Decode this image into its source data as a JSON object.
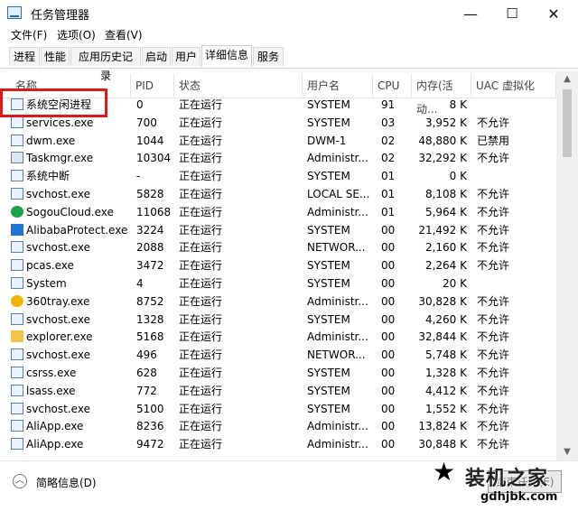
{
  "window": {
    "title": "任务管理器",
    "minimize": "—",
    "maximize": "☐",
    "close": "✕"
  },
  "menu": [
    "文件(F)",
    "选项(O)",
    "查看(V)"
  ],
  "tabs": [
    "进程",
    "性能",
    "应用历史记录",
    "启动",
    "用户",
    "详细信息",
    "服务"
  ],
  "active_tab": "详细信息",
  "columns": {
    "name": "名称",
    "pid": "PID",
    "status": "状态",
    "user": "用户名",
    "cpu": "CPU",
    "memory": "内存(活动...",
    "uac": "UAC 虚拟化"
  },
  "rows": [
    {
      "name": "系统空闲进程",
      "pid": "0",
      "status": "正在运行",
      "user": "SYSTEM",
      "cpu": "91",
      "memory": "8 K",
      "uac": "",
      "icon": "window-icon"
    },
    {
      "name": "services.exe",
      "pid": "700",
      "status": "正在运行",
      "user": "SYSTEM",
      "cpu": "03",
      "memory": "3,952 K",
      "uac": "不允许",
      "icon": "window-icon"
    },
    {
      "name": "dwm.exe",
      "pid": "1044",
      "status": "正在运行",
      "user": "DWM-1",
      "cpu": "02",
      "memory": "48,880 K",
      "uac": "已禁用",
      "icon": "window-icon"
    },
    {
      "name": "Taskmgr.exe",
      "pid": "10304",
      "status": "正在运行",
      "user": "Administr...",
      "cpu": "02",
      "memory": "32,292 K",
      "uac": "不允许",
      "icon": "taskmgr-icon"
    },
    {
      "name": "系统中断",
      "pid": "-",
      "status": "正在运行",
      "user": "SYSTEM",
      "cpu": "01",
      "memory": "0 K",
      "uac": "",
      "icon": "window-icon"
    },
    {
      "name": "svchost.exe",
      "pid": "5828",
      "status": "正在运行",
      "user": "LOCAL SE...",
      "cpu": "01",
      "memory": "8,108 K",
      "uac": "不允许",
      "icon": "window-icon"
    },
    {
      "name": "SogouCloud.exe",
      "pid": "11068",
      "status": "正在运行",
      "user": "Administr...",
      "cpu": "01",
      "memory": "5,964 K",
      "uac": "不允许",
      "icon": "sogou-icon"
    },
    {
      "name": "AlibabaProtect.exe",
      "pid": "3224",
      "status": "正在运行",
      "user": "SYSTEM",
      "cpu": "00",
      "memory": "21,492 K",
      "uac": "不允许",
      "icon": "alibaba-icon"
    },
    {
      "name": "svchost.exe",
      "pid": "2088",
      "status": "正在运行",
      "user": "NETWOR...",
      "cpu": "00",
      "memory": "2,160 K",
      "uac": "不允许",
      "icon": "window-icon"
    },
    {
      "name": "pcas.exe",
      "pid": "3472",
      "status": "正在运行",
      "user": "SYSTEM",
      "cpu": "00",
      "memory": "2,264 K",
      "uac": "不允许",
      "icon": "window-icon"
    },
    {
      "name": "System",
      "pid": "4",
      "status": "正在运行",
      "user": "SYSTEM",
      "cpu": "00",
      "memory": "20 K",
      "uac": "",
      "icon": "window-icon"
    },
    {
      "name": "360tray.exe",
      "pid": "8752",
      "status": "正在运行",
      "user": "Administr...",
      "cpu": "00",
      "memory": "30,828 K",
      "uac": "不允许",
      "icon": "360-icon"
    },
    {
      "name": "svchost.exe",
      "pid": "1328",
      "status": "正在运行",
      "user": "SYSTEM",
      "cpu": "00",
      "memory": "4,260 K",
      "uac": "不允许",
      "icon": "window-icon"
    },
    {
      "name": "explorer.exe",
      "pid": "5168",
      "status": "正在运行",
      "user": "Administr...",
      "cpu": "00",
      "memory": "32,844 K",
      "uac": "不允许",
      "icon": "folder-icon"
    },
    {
      "name": "svchost.exe",
      "pid": "496",
      "status": "正在运行",
      "user": "NETWOR...",
      "cpu": "00",
      "memory": "5,748 K",
      "uac": "不允许",
      "icon": "window-icon"
    },
    {
      "name": "csrss.exe",
      "pid": "628",
      "status": "正在运行",
      "user": "SYSTEM",
      "cpu": "00",
      "memory": "1,328 K",
      "uac": "不允许",
      "icon": "window-icon"
    },
    {
      "name": "lsass.exe",
      "pid": "772",
      "status": "正在运行",
      "user": "SYSTEM",
      "cpu": "00",
      "memory": "4,412 K",
      "uac": "不允许",
      "icon": "window-icon"
    },
    {
      "name": "svchost.exe",
      "pid": "5100",
      "status": "正在运行",
      "user": "SYSTEM",
      "cpu": "00",
      "memory": "1,552 K",
      "uac": "不允许",
      "icon": "window-icon"
    },
    {
      "name": "AliApp.exe",
      "pid": "8236",
      "status": "正在运行",
      "user": "Administr...",
      "cpu": "00",
      "memory": "13,824 K",
      "uac": "不允许",
      "icon": "window-icon"
    },
    {
      "name": "AliApp.exe",
      "pid": "9472",
      "status": "正在运行",
      "user": "Administr...",
      "cpu": "00",
      "memory": "30,848 K",
      "uac": "不允许",
      "icon": "window-icon"
    }
  ],
  "footer": {
    "fewer_details": "简略信息(D)",
    "end_task": "结束任务(E)"
  },
  "watermark": {
    "cn": "装机之家",
    "url": "gdhjbk.com"
  },
  "colors": {
    "highlight": "#e01818"
  }
}
